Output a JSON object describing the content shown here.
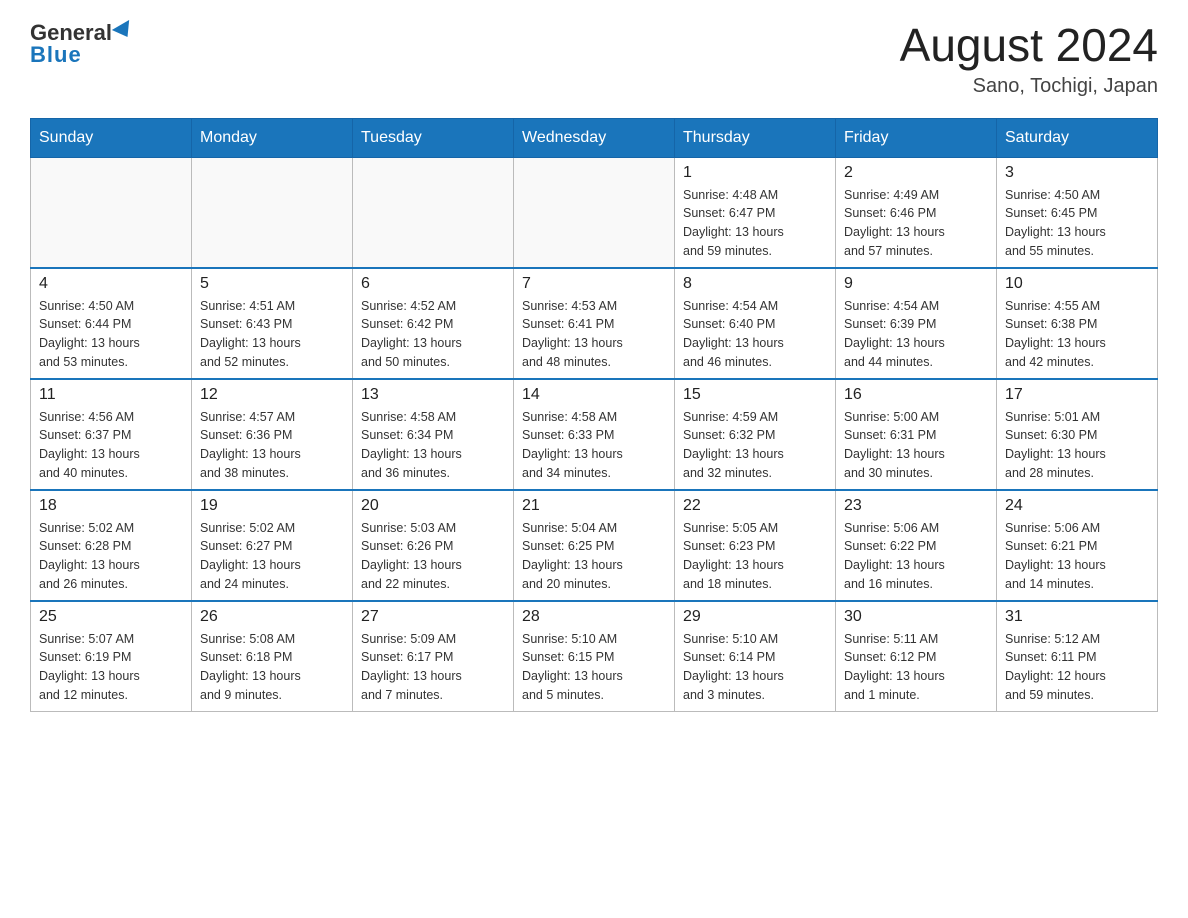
{
  "header": {
    "logo_general": "General",
    "logo_blue": "Blue",
    "month_year": "August 2024",
    "location": "Sano, Tochigi, Japan"
  },
  "weekdays": [
    "Sunday",
    "Monday",
    "Tuesday",
    "Wednesday",
    "Thursday",
    "Friday",
    "Saturday"
  ],
  "weeks": [
    [
      {
        "day": "",
        "info": ""
      },
      {
        "day": "",
        "info": ""
      },
      {
        "day": "",
        "info": ""
      },
      {
        "day": "",
        "info": ""
      },
      {
        "day": "1",
        "info": "Sunrise: 4:48 AM\nSunset: 6:47 PM\nDaylight: 13 hours\nand 59 minutes."
      },
      {
        "day": "2",
        "info": "Sunrise: 4:49 AM\nSunset: 6:46 PM\nDaylight: 13 hours\nand 57 minutes."
      },
      {
        "day": "3",
        "info": "Sunrise: 4:50 AM\nSunset: 6:45 PM\nDaylight: 13 hours\nand 55 minutes."
      }
    ],
    [
      {
        "day": "4",
        "info": "Sunrise: 4:50 AM\nSunset: 6:44 PM\nDaylight: 13 hours\nand 53 minutes."
      },
      {
        "day": "5",
        "info": "Sunrise: 4:51 AM\nSunset: 6:43 PM\nDaylight: 13 hours\nand 52 minutes."
      },
      {
        "day": "6",
        "info": "Sunrise: 4:52 AM\nSunset: 6:42 PM\nDaylight: 13 hours\nand 50 minutes."
      },
      {
        "day": "7",
        "info": "Sunrise: 4:53 AM\nSunset: 6:41 PM\nDaylight: 13 hours\nand 48 minutes."
      },
      {
        "day": "8",
        "info": "Sunrise: 4:54 AM\nSunset: 6:40 PM\nDaylight: 13 hours\nand 46 minutes."
      },
      {
        "day": "9",
        "info": "Sunrise: 4:54 AM\nSunset: 6:39 PM\nDaylight: 13 hours\nand 44 minutes."
      },
      {
        "day": "10",
        "info": "Sunrise: 4:55 AM\nSunset: 6:38 PM\nDaylight: 13 hours\nand 42 minutes."
      }
    ],
    [
      {
        "day": "11",
        "info": "Sunrise: 4:56 AM\nSunset: 6:37 PM\nDaylight: 13 hours\nand 40 minutes."
      },
      {
        "day": "12",
        "info": "Sunrise: 4:57 AM\nSunset: 6:36 PM\nDaylight: 13 hours\nand 38 minutes."
      },
      {
        "day": "13",
        "info": "Sunrise: 4:58 AM\nSunset: 6:34 PM\nDaylight: 13 hours\nand 36 minutes."
      },
      {
        "day": "14",
        "info": "Sunrise: 4:58 AM\nSunset: 6:33 PM\nDaylight: 13 hours\nand 34 minutes."
      },
      {
        "day": "15",
        "info": "Sunrise: 4:59 AM\nSunset: 6:32 PM\nDaylight: 13 hours\nand 32 minutes."
      },
      {
        "day": "16",
        "info": "Sunrise: 5:00 AM\nSunset: 6:31 PM\nDaylight: 13 hours\nand 30 minutes."
      },
      {
        "day": "17",
        "info": "Sunrise: 5:01 AM\nSunset: 6:30 PM\nDaylight: 13 hours\nand 28 minutes."
      }
    ],
    [
      {
        "day": "18",
        "info": "Sunrise: 5:02 AM\nSunset: 6:28 PM\nDaylight: 13 hours\nand 26 minutes."
      },
      {
        "day": "19",
        "info": "Sunrise: 5:02 AM\nSunset: 6:27 PM\nDaylight: 13 hours\nand 24 minutes."
      },
      {
        "day": "20",
        "info": "Sunrise: 5:03 AM\nSunset: 6:26 PM\nDaylight: 13 hours\nand 22 minutes."
      },
      {
        "day": "21",
        "info": "Sunrise: 5:04 AM\nSunset: 6:25 PM\nDaylight: 13 hours\nand 20 minutes."
      },
      {
        "day": "22",
        "info": "Sunrise: 5:05 AM\nSunset: 6:23 PM\nDaylight: 13 hours\nand 18 minutes."
      },
      {
        "day": "23",
        "info": "Sunrise: 5:06 AM\nSunset: 6:22 PM\nDaylight: 13 hours\nand 16 minutes."
      },
      {
        "day": "24",
        "info": "Sunrise: 5:06 AM\nSunset: 6:21 PM\nDaylight: 13 hours\nand 14 minutes."
      }
    ],
    [
      {
        "day": "25",
        "info": "Sunrise: 5:07 AM\nSunset: 6:19 PM\nDaylight: 13 hours\nand 12 minutes."
      },
      {
        "day": "26",
        "info": "Sunrise: 5:08 AM\nSunset: 6:18 PM\nDaylight: 13 hours\nand 9 minutes."
      },
      {
        "day": "27",
        "info": "Sunrise: 5:09 AM\nSunset: 6:17 PM\nDaylight: 13 hours\nand 7 minutes."
      },
      {
        "day": "28",
        "info": "Sunrise: 5:10 AM\nSunset: 6:15 PM\nDaylight: 13 hours\nand 5 minutes."
      },
      {
        "day": "29",
        "info": "Sunrise: 5:10 AM\nSunset: 6:14 PM\nDaylight: 13 hours\nand 3 minutes."
      },
      {
        "day": "30",
        "info": "Sunrise: 5:11 AM\nSunset: 6:12 PM\nDaylight: 13 hours\nand 1 minute."
      },
      {
        "day": "31",
        "info": "Sunrise: 5:12 AM\nSunset: 6:11 PM\nDaylight: 12 hours\nand 59 minutes."
      }
    ]
  ]
}
